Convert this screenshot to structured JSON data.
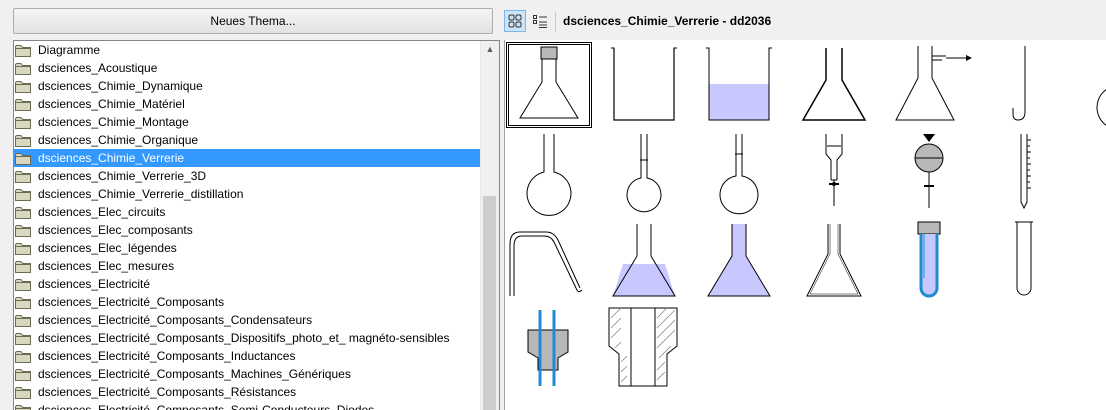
{
  "left_panel": {
    "new_theme_button": "Neues Thema...",
    "themes": [
      {
        "label": "Diagramme",
        "selected": false
      },
      {
        "label": "dsciences_Acoustique",
        "selected": false
      },
      {
        "label": "dsciences_Chimie_Dynamique",
        "selected": false
      },
      {
        "label": "dsciences_Chimie_Matériel",
        "selected": false
      },
      {
        "label": "dsciences_Chimie_Montage",
        "selected": false
      },
      {
        "label": "dsciences_Chimie_Organique",
        "selected": false
      },
      {
        "label": "dsciences_Chimie_Verrerie",
        "selected": true
      },
      {
        "label": "dsciences_Chimie_Verrerie_3D",
        "selected": false
      },
      {
        "label": "dsciences_Chimie_Verrerie_distillation",
        "selected": false
      },
      {
        "label": "dsciences_Elec_circuits",
        "selected": false
      },
      {
        "label": "dsciences_Elec_composants",
        "selected": false
      },
      {
        "label": "dsciences_Elec_légendes",
        "selected": false
      },
      {
        "label": "dsciences_Elec_mesures",
        "selected": false
      },
      {
        "label": "dsciences_Electricité",
        "selected": false
      },
      {
        "label": "dsciences_Electricité_Composants",
        "selected": false
      },
      {
        "label": "dsciences_Electricité_Composants_Condensateurs",
        "selected": false
      },
      {
        "label": "dsciences_Electricité_Composants_Dispositifs_photo_et_ magnéto-sensibles",
        "selected": false
      },
      {
        "label": "dsciences_Electricité_Composants_Inductances",
        "selected": false
      },
      {
        "label": "dsciences_Electricité_Composants_Machines_Génériques",
        "selected": false
      },
      {
        "label": "dsciences_Electricité_Composants_Résistances",
        "selected": false
      },
      {
        "label": "dsciences_Electricité_Composants_Semi-Conducteurs_Diodes",
        "selected": false
      }
    ]
  },
  "gallery": {
    "title": "dsciences_Chimie_Verrerie - dd2036",
    "view_modes": [
      "icon-view",
      "detail-view"
    ],
    "active_view": "icon-view",
    "items": [
      {
        "icon": "erlenmeyer-flask-stoppered-icon",
        "selected": true
      },
      {
        "icon": "beaker-empty-icon"
      },
      {
        "icon": "beaker-with-liquid-icon"
      },
      {
        "icon": "erlenmeyer-flask-icon"
      },
      {
        "icon": "filtering-flask-icon"
      },
      {
        "icon": "j-tube-icon"
      },
      {
        "icon": "round-bottom-flask-stoppered-icon"
      },
      {
        "icon": "round-bottom-flask-icon"
      },
      {
        "icon": "volumetric-flask-small-icon"
      },
      {
        "icon": "volumetric-flask-icon"
      },
      {
        "icon": "dropping-funnel-icon"
      },
      {
        "icon": "separatory-funnel-icon"
      },
      {
        "icon": "graduated-pipette-icon"
      },
      {
        "icon": "volumetric-pipette-icon"
      },
      {
        "icon": "bent-glass-tube-icon"
      },
      {
        "icon": "erlenmeyer-with-liquid-icon"
      },
      {
        "icon": "conical-flask-filled-icon"
      },
      {
        "icon": "erlenmeyer-tall-icon"
      },
      {
        "icon": "test-tube-stoppered-icon"
      },
      {
        "icon": "test-tube-icon"
      },
      {
        "icon": "u-tube-icon"
      },
      {
        "icon": "stopper-two-tubes-icon"
      },
      {
        "icon": "rubber-stopper-icon"
      }
    ]
  },
  "colors": {
    "selection": "#3399ff",
    "liquid": "#c8c8ff",
    "tube_blue": "#1f8ccf",
    "stopper_gray": "#b8b8b8",
    "folder": "#d8d8c0"
  }
}
